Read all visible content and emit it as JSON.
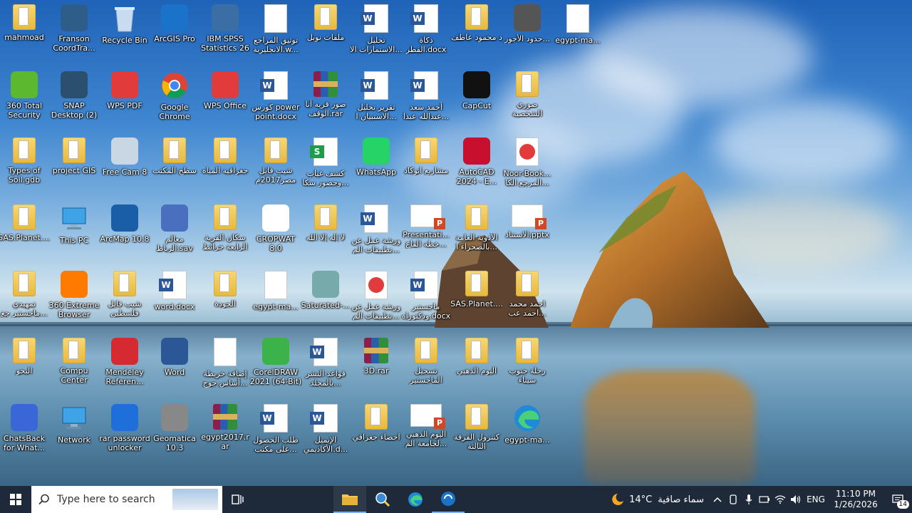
{
  "desktop_icons": [
    {
      "id": "mahmoad",
      "label": "mahmoad",
      "kind": "folder"
    },
    {
      "id": "franson",
      "label": "Franson CoordTra...",
      "kind": "app",
      "color": "#2e5d8a"
    },
    {
      "id": "recycle",
      "label": "Recycle Bin",
      "kind": "recycle"
    },
    {
      "id": "arcgis-pro",
      "label": "ArcGIS Pro",
      "kind": "app",
      "color": "#1a73c9"
    },
    {
      "id": "spss",
      "label": "IBM SPSS Statistics 26",
      "kind": "app",
      "color": "#3a6ea5"
    },
    {
      "id": "tawtheeq",
      "label": "توثيق المراجع الانجليزية.w...",
      "kind": "blank"
    },
    {
      "id": "malafat-nobel",
      "label": "ملفات نوبل",
      "kind": "folder"
    },
    {
      "id": "tahleel-istimarat",
      "label": "تحليل الاستمارات الا...",
      "kind": "word"
    },
    {
      "id": "zakat",
      "label": "ذكاة الفطر.docx",
      "kind": "word"
    },
    {
      "id": "d-mahmoud",
      "label": "د محمود عاطف",
      "kind": "folder"
    },
    {
      "id": "google-earth",
      "label": "حدود الأجور...",
      "kind": "app",
      "color": "#555"
    },
    {
      "id": "egypt-ma-1",
      "label": "egypt-ma...",
      "kind": "blank"
    },
    {
      "id": "360-security",
      "label": "360 Total Security",
      "kind": "app",
      "color": "#5cb82e"
    },
    {
      "id": "snap",
      "label": "SNAP Desktop (2)",
      "kind": "app",
      "color": "#2b4f6e"
    },
    {
      "id": "wps-pdf",
      "label": "WPS PDF",
      "kind": "app",
      "color": "#e23b3b"
    },
    {
      "id": "chrome",
      "label": "Google Chrome",
      "kind": "chrome"
    },
    {
      "id": "wps-office",
      "label": "WPS Office",
      "kind": "app",
      "color": "#e23b3b"
    },
    {
      "id": "power-point",
      "label": "كورس power point.docx",
      "kind": "word"
    },
    {
      "id": "sowar-qarya",
      "label": "صور قرية أنا الوقف.rar",
      "kind": "rar"
    },
    {
      "id": "taqreer",
      "label": "تقرير تحليل الاستبيان ا...",
      "kind": "word"
    },
    {
      "id": "ahmed-saad",
      "label": "أحمد سعد عبدالله عبدا...",
      "kind": "word"
    },
    {
      "id": "capcut",
      "label": "CapCut",
      "kind": "app",
      "color": "#111"
    },
    {
      "id": "sowari",
      "label": "صوري الشخصية",
      "kind": "folder"
    },
    {
      "id": "types-soil",
      "label": "Types of Soil.gdb",
      "kind": "folder"
    },
    {
      "id": "project-gis",
      "label": "project GIS",
      "kind": "folder"
    },
    {
      "id": "free-cam",
      "label": "Free Cam 8",
      "kind": "app",
      "color": "#c9d6e3"
    },
    {
      "id": "sath-maktab",
      "label": "سطح المكتب",
      "kind": "folder"
    },
    {
      "id": "geography-water",
      "label": "جغرافية المياه",
      "kind": "folder"
    },
    {
      "id": "shabab-fail",
      "label": "شيب فايل مصر2017م",
      "kind": "folder"
    },
    {
      "id": "kashf",
      "label": "كشف غياب وحضور سكا...",
      "kind": "sheet"
    },
    {
      "id": "whatsapp",
      "label": "WhatsApp",
      "kind": "app",
      "color": "#25d366"
    },
    {
      "id": "mashareea",
      "label": "مشاريع اتوكاد",
      "kind": "folder"
    },
    {
      "id": "autocad",
      "label": "AutoCAD 2024 - E...",
      "kind": "app",
      "color": "#c8102e"
    },
    {
      "id": "noor-book",
      "label": "Noor-Book... المرجع الكا...",
      "kind": "pdf"
    },
    {
      "id": "sas-planet",
      "label": "SAS.Planet....",
      "kind": "folder"
    },
    {
      "id": "this-pc",
      "label": "This PC",
      "kind": "pc"
    },
    {
      "id": "arcmap",
      "label": "ArcMap 10.8",
      "kind": "app",
      "color": "#1b5ea8"
    },
    {
      "id": "maalim",
      "label": "معالم الرباط.sav",
      "kind": "app",
      "color": "#4a6fbf"
    },
    {
      "id": "skkan",
      "label": "سكان القرية الرابعة خرائط",
      "kind": "folder"
    },
    {
      "id": "cropwat",
      "label": "CROPWAT 8.0",
      "kind": "app",
      "color": "#ffffff"
    },
    {
      "id": "la-ilah",
      "label": "لا إله إلا الله",
      "kind": "folder"
    },
    {
      "id": "warsha-1",
      "label": "ورشة عمل عن تطبيقات الم...",
      "kind": "word"
    },
    {
      "id": "presentation",
      "label": "Presentati... خطة القاع...",
      "kind": "ppt"
    },
    {
      "id": "adwiya",
      "label": "الأدوية العامة بالصحراء ا...",
      "kind": "folder"
    },
    {
      "id": "al-istinad",
      "label": "الاستناد.pptx",
      "kind": "ppt"
    },
    {
      "id": "tamheedi",
      "label": "تمهيدي ماجستير جغ...",
      "kind": "folder"
    },
    {
      "id": "360-browser",
      "label": "360 Extreme Browser",
      "kind": "app",
      "color": "#ff7a00"
    },
    {
      "id": "shabab-falastin",
      "label": "شيب فايل فلسطين",
      "kind": "folder"
    },
    {
      "id": "word-docx",
      "label": "word.docx",
      "kind": "word"
    },
    {
      "id": "al-jawda",
      "label": "الجودة",
      "kind": "folder"
    },
    {
      "id": "egypt-ma-jpg",
      "label": "egypt-ma...",
      "kind": "blank"
    },
    {
      "id": "saturated",
      "label": "Saturated-...",
      "kind": "app",
      "color": "#7aa"
    },
    {
      "id": "warsha-2",
      "label": "ورشة عمل عن تطبيقات الم...",
      "kind": "pdf"
    },
    {
      "id": "majister",
      "label": "ماجستير ودكتوراه.docx",
      "kind": "word"
    },
    {
      "id": "sas-planet-2",
      "label": "SAS.Planet....",
      "kind": "folder"
    },
    {
      "id": "ahmed-mohamed",
      "label": "احمد محمد احمد عب...",
      "kind": "folder"
    },
    {
      "id": "al-bahth",
      "label": "البحو",
      "kind": "folder"
    },
    {
      "id": "compu-center",
      "label": "Compu Center",
      "kind": "folder"
    },
    {
      "id": "mendeley",
      "label": "Mendeley Referen...",
      "kind": "app",
      "color": "#d62a33"
    },
    {
      "id": "word-app",
      "label": "Word",
      "kind": "app",
      "color": "#2b5797"
    },
    {
      "id": "idafa",
      "label": "إضافة خريطة أساس جوج...",
      "kind": "blank"
    },
    {
      "id": "coreldraw",
      "label": "CorelDRAW 2021 (64-Bit)",
      "kind": "app",
      "color": "#3bb34a"
    },
    {
      "id": "qawaid",
      "label": "قواعد النشر بالمجلد...",
      "kind": "word"
    },
    {
      "id": "3d-rar",
      "label": "3D.rar",
      "kind": "rar"
    },
    {
      "id": "tasjeel",
      "label": "تسجيل الماجستير",
      "kind": "folder"
    },
    {
      "id": "al-yawm",
      "label": "اليوم الذهبي",
      "kind": "folder"
    },
    {
      "id": "rihla",
      "label": "رحلة جنوب سيناء",
      "kind": "folder"
    },
    {
      "id": "chatsback",
      "label": "ChatsBack for What...",
      "kind": "app",
      "color": "#3a67d8"
    },
    {
      "id": "network",
      "label": "Network",
      "kind": "pc"
    },
    {
      "id": "rar-password",
      "label": "rar password unlocker",
      "kind": "app",
      "color": "#1e6fd9"
    },
    {
      "id": "geomatica",
      "label": "Geomatica 10.3",
      "kind": "app",
      "color": "#888"
    },
    {
      "id": "egypt2017",
      "label": "egypt2017.rar",
      "kind": "rar"
    },
    {
      "id": "talab",
      "label": "طلب الحصول على مكتب...",
      "kind": "word"
    },
    {
      "id": "al-email",
      "label": "الإيميل الأكاديمي.d...",
      "kind": "word"
    },
    {
      "id": "ihsaa",
      "label": "احصاء جغرافي",
      "kind": "folder"
    },
    {
      "id": "al-yawm-2",
      "label": "اليوم الذهبي لجامعة الم...",
      "kind": "ppt"
    },
    {
      "id": "kontrol",
      "label": "كنترول الفرقة الثالثة",
      "kind": "folder"
    },
    {
      "id": "egypt-ma-edge",
      "label": "egypt-ma...",
      "kind": "edge"
    }
  ],
  "taskbar": {
    "search_placeholder": "Type here to search",
    "weather_temp": "14°C",
    "weather_text": "سماء صافية",
    "language": "ENG",
    "time": "11:10 PM",
    "date": "1/26/2026",
    "notification_count": "14"
  },
  "colors": {
    "taskbar_bg": "#1e2a3a",
    "accent": "#2b5797"
  }
}
